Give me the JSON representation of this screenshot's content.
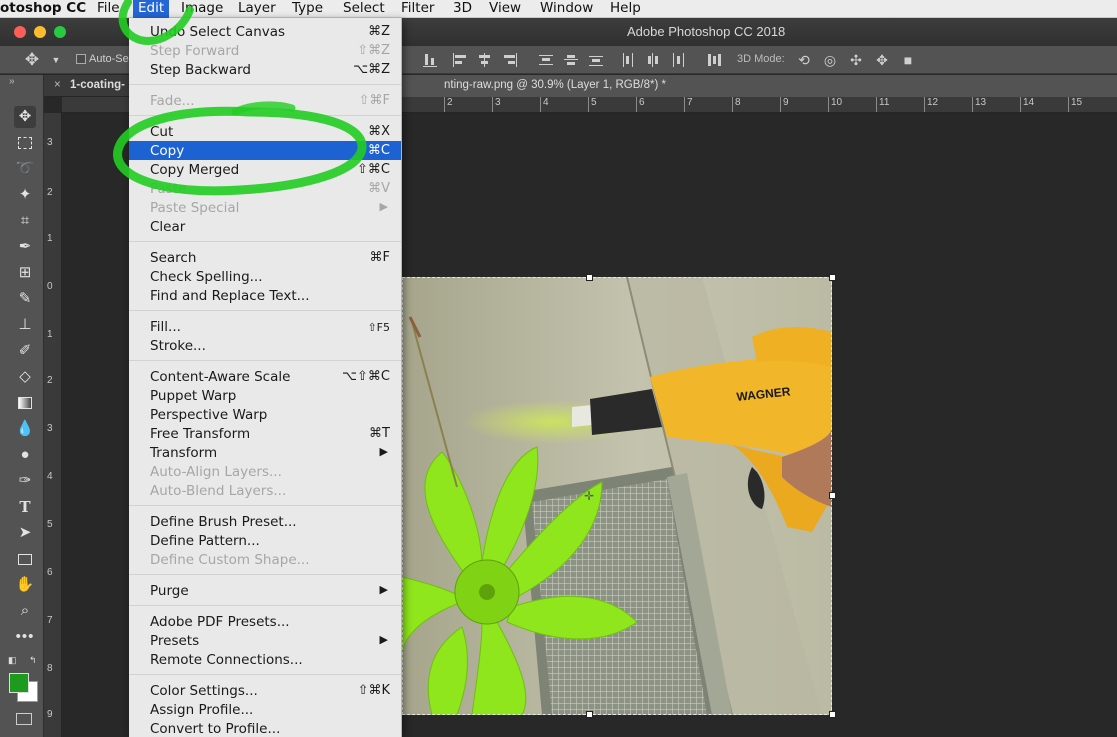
{
  "menubar": {
    "app": "otoshop CC",
    "items": [
      "File",
      "Edit",
      "Image",
      "Layer",
      "Type",
      "Select",
      "Filter",
      "3D",
      "View",
      "Window",
      "Help"
    ]
  },
  "window": {
    "title": "Adobe Photoshop CC 2018"
  },
  "options": {
    "auto_select": "Auto-Se",
    "mode_3d": "3D Mode:"
  },
  "tabs": {
    "first": "1-coating-",
    "active": "nting-raw.png @ 30.9% (Layer 1, RGB/8*) *"
  },
  "ruler": {
    "h_ticks": [
      "2",
      "3",
      "4",
      "5",
      "6",
      "7",
      "8",
      "9",
      "10",
      "11",
      "12",
      "13",
      "14",
      "15"
    ],
    "v_ticks": [
      "3",
      "2",
      "1",
      "0",
      "1",
      "2",
      "3",
      "4",
      "5",
      "6",
      "7",
      "8",
      "9"
    ]
  },
  "colors": {
    "foreground": "#1e9b1e",
    "background": "#ffffff",
    "highlight": "#1d62d3",
    "annotation": "#22cc22"
  },
  "edit_menu": {
    "items": [
      {
        "label": "Undo Select Canvas",
        "shortcut": "⌘Z",
        "disabled": false
      },
      {
        "label": "Step Forward",
        "shortcut": "⇧⌘Z",
        "disabled": true
      },
      {
        "label": "Step Backward",
        "shortcut": "⌥⌘Z",
        "disabled": false
      },
      {
        "label": "Fade...",
        "shortcut": "⇧⌘F",
        "disabled": true
      },
      {
        "label": "Cut",
        "shortcut": "⌘X",
        "disabled": false
      },
      {
        "label": "Copy",
        "shortcut": "⌘C",
        "disabled": false,
        "highlighted": true
      },
      {
        "label": "Copy Merged",
        "shortcut": "⇧⌘C",
        "disabled": false
      },
      {
        "label": "Paste",
        "shortcut": "⌘V",
        "disabled": true
      },
      {
        "label": "Paste Special",
        "shortcut": "▶",
        "disabled": true
      },
      {
        "label": "Clear",
        "shortcut": "",
        "disabled": false
      },
      {
        "label": "Search",
        "shortcut": "⌘F",
        "disabled": false
      },
      {
        "label": "Check Spelling...",
        "shortcut": "",
        "disabled": false
      },
      {
        "label": "Find and Replace Text...",
        "shortcut": "",
        "disabled": false
      },
      {
        "label": "Fill...",
        "shortcut": "⇧F5",
        "disabled": false
      },
      {
        "label": "Stroke...",
        "shortcut": "",
        "disabled": false
      },
      {
        "label": "Content-Aware Scale",
        "shortcut": "⌥⇧⌘C",
        "disabled": false
      },
      {
        "label": "Puppet Warp",
        "shortcut": "",
        "disabled": false
      },
      {
        "label": "Perspective Warp",
        "shortcut": "",
        "disabled": false
      },
      {
        "label": "Free Transform",
        "shortcut": "⌘T",
        "disabled": false
      },
      {
        "label": "Transform",
        "shortcut": "▶",
        "disabled": false
      },
      {
        "label": "Auto-Align Layers...",
        "shortcut": "",
        "disabled": true
      },
      {
        "label": "Auto-Blend Layers...",
        "shortcut": "",
        "disabled": true
      },
      {
        "label": "Define Brush Preset...",
        "shortcut": "",
        "disabled": false
      },
      {
        "label": "Define Pattern...",
        "shortcut": "",
        "disabled": false
      },
      {
        "label": "Define Custom Shape...",
        "shortcut": "",
        "disabled": true
      },
      {
        "label": "Purge",
        "shortcut": "▶",
        "disabled": false
      },
      {
        "label": "Adobe PDF Presets...",
        "shortcut": "",
        "disabled": false
      },
      {
        "label": "Presets",
        "shortcut": "▶",
        "disabled": false
      },
      {
        "label": "Remote Connections...",
        "shortcut": "",
        "disabled": false
      },
      {
        "label": "Color Settings...",
        "shortcut": "⇧⌘K",
        "disabled": false
      },
      {
        "label": "Assign Profile...",
        "shortcut": "",
        "disabled": false
      },
      {
        "label": "Convert to Profile...",
        "shortcut": "",
        "disabled": false
      }
    ]
  },
  "image": {
    "brand_text": "WAGNER"
  }
}
